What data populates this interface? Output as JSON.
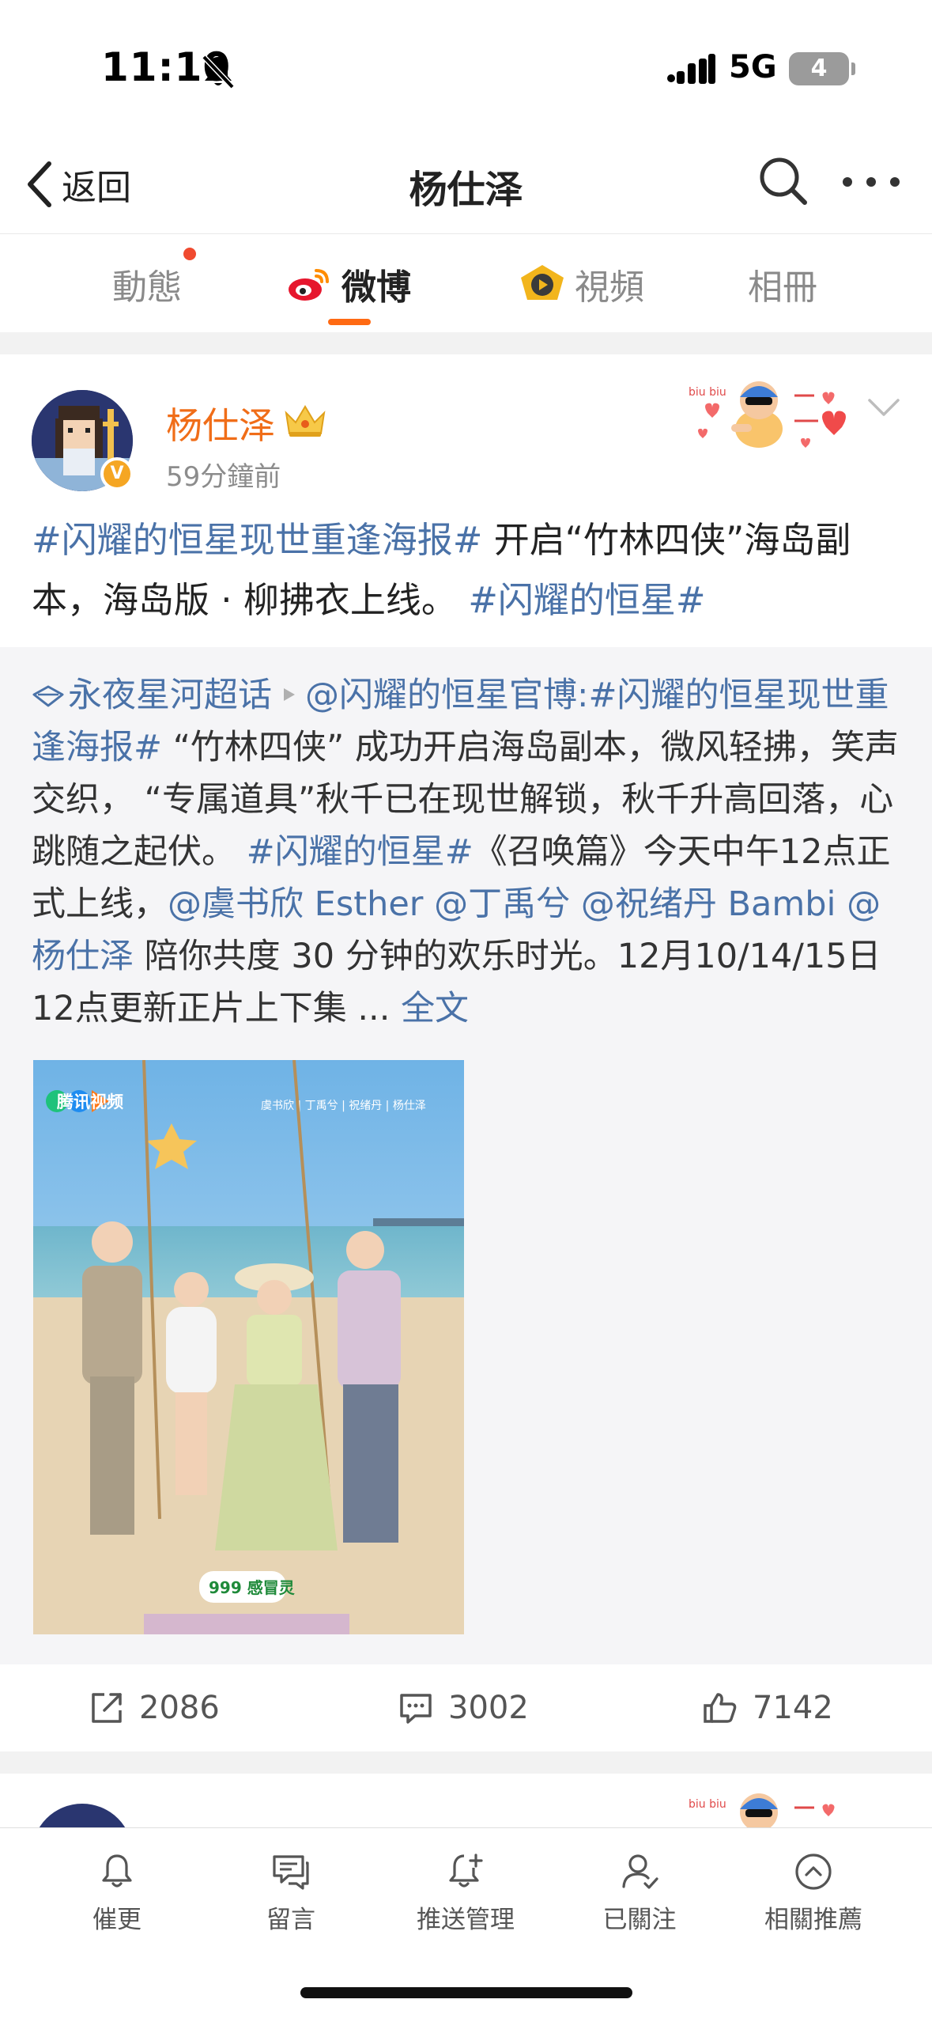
{
  "status_bar": {
    "time": "11:10",
    "network": "5G",
    "battery": "4"
  },
  "nav": {
    "back_label": "返回",
    "title": "杨仕泽"
  },
  "tabs": [
    {
      "label": "動態",
      "has_dot": true
    },
    {
      "label": "微博",
      "active": true
    },
    {
      "label": "視頻"
    },
    {
      "label": "相冊"
    }
  ],
  "post": {
    "author": "杨仕泽",
    "verified_mark": "V",
    "time": "59分鐘前",
    "text": {
      "tag1": "#闪耀的恒星现世重逢海报#",
      "body1": " 开启“竹林四侠”海岛副本，海岛版 · 柳拂衣上线。 ",
      "tag2": "#闪耀的恒星#"
    },
    "retweet": {
      "supertopic": "永夜星河超话",
      "source": "@闪耀的恒星官博",
      "colon": ":",
      "tag1": "#闪耀的恒星现世重逢海报#",
      "body1": " “竹林四侠” 成功开启海岛副本，微风轻拂，笑声交织， “专属道具”秋千已在现世解锁，秋千升高回落，心跳随之起伏。 ",
      "tag2": "#闪耀的恒星#",
      "body2": "《召唤篇》今天中午12点正式上线，",
      "mention1": "@虞书欣 Esther",
      "mention2": "@丁禹兮",
      "mention3": "@祝绪丹 Bambi",
      "mention4": "@杨仕泽",
      "body3": " 陪你共度 30 分钟的欢乐时光。12月10/14/15日12点更新正片上下集 ... ",
      "full_text": "全文"
    },
    "poster": {
      "platform": "腾讯视频",
      "cast": "虞书欣 | 丁禹兮 | 祝绪丹 | 杨仕泽",
      "sponsor": "999 感冒灵"
    },
    "actions": {
      "reposts": "2086",
      "comments": "3002",
      "likes": "7142"
    }
  },
  "toolbar": [
    {
      "label": "催更",
      "icon": "bell-icon"
    },
    {
      "label": "留言",
      "icon": "message-icon"
    },
    {
      "label": "推送管理",
      "icon": "bell-plus-icon"
    },
    {
      "label": "已關注",
      "icon": "user-check-icon"
    },
    {
      "label": "相關推薦",
      "icon": "chevron-up-circle-icon"
    }
  ],
  "colors": {
    "accent": "#ff6a13",
    "link": "#4a72a8",
    "author": "#f06d18"
  }
}
